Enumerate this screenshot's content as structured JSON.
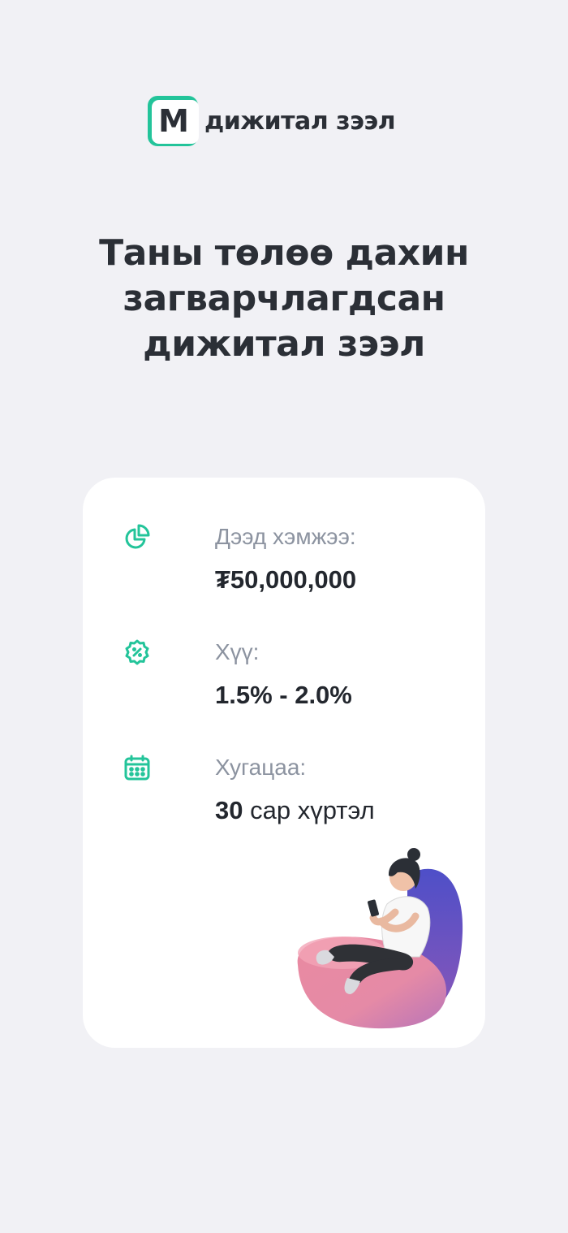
{
  "brand": {
    "logo_letter": "М",
    "logo_text": "дижитал зээл",
    "accent_color": "#23c49a"
  },
  "headline": {
    "line1": "Таны төлөө дахин",
    "line2": "загварчлагдсан",
    "line3": "дижитал зээл"
  },
  "details": [
    {
      "icon": "pie-chart-icon",
      "label": "Дээд хэмжээ:",
      "value_bold": "₮50,000,000",
      "value_regular": ""
    },
    {
      "icon": "percent-badge-icon",
      "label": "Хүү:",
      "value_bold": "1.5% - 2.0%",
      "value_regular": ""
    },
    {
      "icon": "calendar-icon",
      "label": "Хугацаа:",
      "value_bold": "30",
      "value_regular": " сар хүртэл"
    }
  ]
}
